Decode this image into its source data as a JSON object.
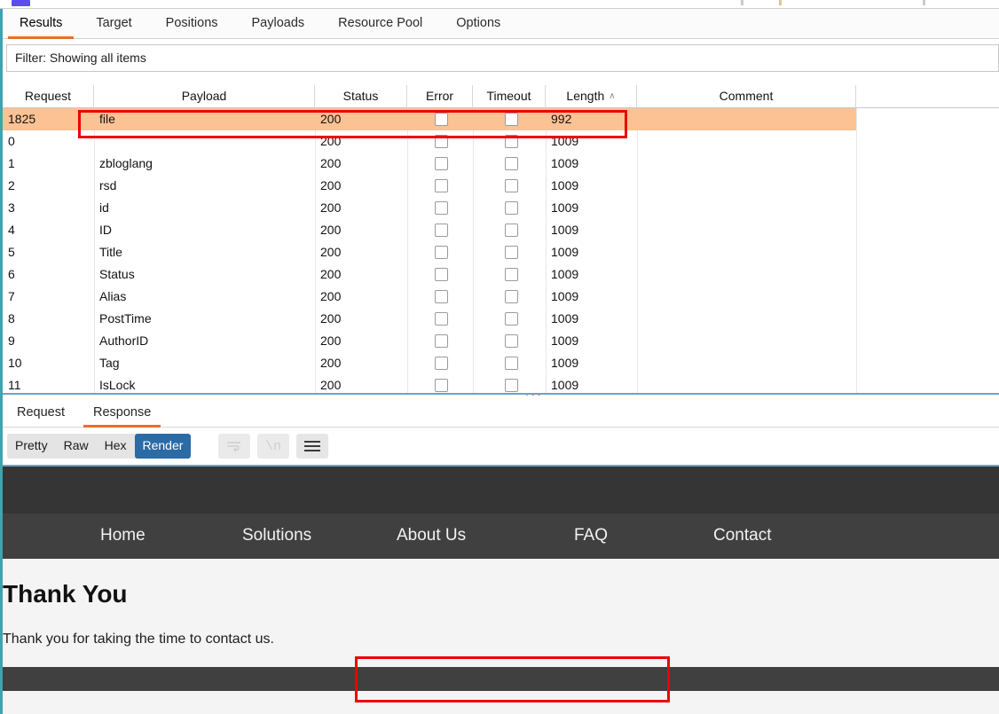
{
  "app": {
    "name": "Burp Suite Intruder attack window"
  },
  "tabs": {
    "items": [
      {
        "label": "Results",
        "active": true
      },
      {
        "label": "Target",
        "active": false
      },
      {
        "label": "Positions",
        "active": false
      },
      {
        "label": "Payloads",
        "active": false
      },
      {
        "label": "Resource Pool",
        "active": false
      },
      {
        "label": "Options",
        "active": false
      }
    ]
  },
  "filter": {
    "text": "Filter: Showing all items"
  },
  "results_table": {
    "columns": [
      {
        "label": "Request",
        "sort": ""
      },
      {
        "label": "Payload",
        "sort": ""
      },
      {
        "label": "Status",
        "sort": ""
      },
      {
        "label": "Error",
        "sort": ""
      },
      {
        "label": "Timeout",
        "sort": ""
      },
      {
        "label": "Length",
        "sort": "∧"
      },
      {
        "label": "Comment",
        "sort": ""
      }
    ],
    "rows": [
      {
        "request": "1825",
        "payload": "file",
        "status": "200",
        "error": false,
        "timeout": false,
        "length": "992",
        "comment": "",
        "selected": true
      },
      {
        "request": "0",
        "payload": "",
        "status": "200",
        "error": false,
        "timeout": false,
        "length": "1009",
        "comment": "",
        "selected": false
      },
      {
        "request": "1",
        "payload": "zbloglang",
        "status": "200",
        "error": false,
        "timeout": false,
        "length": "1009",
        "comment": "",
        "selected": false
      },
      {
        "request": "2",
        "payload": "rsd",
        "status": "200",
        "error": false,
        "timeout": false,
        "length": "1009",
        "comment": "",
        "selected": false
      },
      {
        "request": "3",
        "payload": "id",
        "status": "200",
        "error": false,
        "timeout": false,
        "length": "1009",
        "comment": "",
        "selected": false
      },
      {
        "request": "4",
        "payload": "ID",
        "status": "200",
        "error": false,
        "timeout": false,
        "length": "1009",
        "comment": "",
        "selected": false
      },
      {
        "request": "5",
        "payload": "Title",
        "status": "200",
        "error": false,
        "timeout": false,
        "length": "1009",
        "comment": "",
        "selected": false
      },
      {
        "request": "6",
        "payload": "Status",
        "status": "200",
        "error": false,
        "timeout": false,
        "length": "1009",
        "comment": "",
        "selected": false
      },
      {
        "request": "7",
        "payload": "Alias",
        "status": "200",
        "error": false,
        "timeout": false,
        "length": "1009",
        "comment": "",
        "selected": false
      },
      {
        "request": "8",
        "payload": "PostTime",
        "status": "200",
        "error": false,
        "timeout": false,
        "length": "1009",
        "comment": "",
        "selected": false
      },
      {
        "request": "9",
        "payload": "AuthorID",
        "status": "200",
        "error": false,
        "timeout": false,
        "length": "1009",
        "comment": "",
        "selected": false
      },
      {
        "request": "10",
        "payload": "Tag",
        "status": "200",
        "error": false,
        "timeout": false,
        "length": "1009",
        "comment": "",
        "selected": false
      },
      {
        "request": "11",
        "payload": "IsLock",
        "status": "200",
        "error": false,
        "timeout": false,
        "length": "1009",
        "comment": "",
        "selected": false
      }
    ]
  },
  "message_tabs": {
    "items": [
      {
        "label": "Request",
        "active": false
      },
      {
        "label": "Response",
        "active": true
      }
    ]
  },
  "view_toolbar": {
    "segments": [
      {
        "label": "Pretty",
        "active": false
      },
      {
        "label": "Raw",
        "active": false
      },
      {
        "label": "Hex",
        "active": false
      },
      {
        "label": "Render",
        "active": true
      }
    ],
    "icons": [
      {
        "name": "word-wrap-icon",
        "glyph": "↩",
        "enabled": false
      },
      {
        "name": "show-newlines-icon",
        "glyph": "\\n",
        "enabled": false
      },
      {
        "name": "menu-icon",
        "glyph": "☰",
        "enabled": true
      }
    ]
  },
  "rendered_page": {
    "nav": [
      {
        "label": "Home"
      },
      {
        "label": "Solutions"
      },
      {
        "label": "About Us"
      },
      {
        "label": "FAQ"
      },
      {
        "label": "Contact"
      }
    ],
    "heading": "Thank You",
    "paragraph": "Thank you for taking the time to contact us."
  },
  "colors": {
    "accent_orange": "#e8702a",
    "selection_orange": "#fcc294",
    "annotation_red": "#ee0000",
    "active_blue": "#2a6ba6",
    "rail_teal": "#3aa6ad",
    "site_dark": "#404040",
    "site_dark_top": "#353535"
  }
}
